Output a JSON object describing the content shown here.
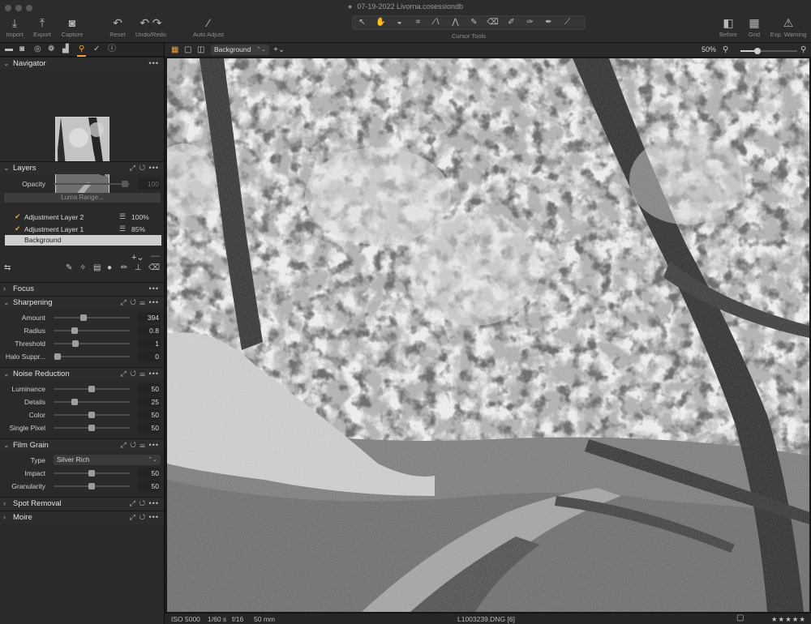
{
  "window": {
    "title": "07-19-2022 Livorna.cosessiondb"
  },
  "toolbar": {
    "import": "Import",
    "export": "Export",
    "capture": "Capture",
    "reset": "Reset",
    "undo_redo": "Undo/Redo",
    "auto_adjust": "Auto Adjust",
    "cursor_tools": "Cursor Tools",
    "before": "Before",
    "grid": "Grid",
    "exp_warning": "Exp. Warning"
  },
  "navigator": {
    "title": "Navigator"
  },
  "layers": {
    "title": "Layers",
    "opacity_label": "Opacity",
    "opacity_value": "100",
    "luma_range": "Luma Range...",
    "items": [
      {
        "name": "Adjustment Layer 2",
        "opacity": "100%"
      },
      {
        "name": "Adjustment Layer 1",
        "opacity": "85%"
      }
    ],
    "background": "Background"
  },
  "focus": {
    "title": "Focus"
  },
  "sharpening": {
    "title": "Sharpening",
    "rows": [
      {
        "label": "Amount",
        "value": "394",
        "level": 0.39
      },
      {
        "label": "Radius",
        "value": "0.8",
        "level": 0.28
      },
      {
        "label": "Threshold",
        "value": "1",
        "level": 0.29
      },
      {
        "label": "Halo Suppr...",
        "value": "0",
        "level": 0.05
      }
    ]
  },
  "noise_reduction": {
    "title": "Noise Reduction",
    "rows": [
      {
        "label": "Luminance",
        "value": "50",
        "level": 0.5
      },
      {
        "label": "Details",
        "value": "25",
        "level": 0.28
      },
      {
        "label": "Color",
        "value": "50",
        "level": 0.5
      },
      {
        "label": "Single Pixel",
        "value": "50",
        "level": 0.5
      }
    ]
  },
  "film_grain": {
    "title": "Film Grain",
    "type_label": "Type",
    "type_value": "Silver Rich",
    "rows": [
      {
        "label": "Impact",
        "value": "50",
        "level": 0.5
      },
      {
        "label": "Granularity",
        "value": "50",
        "level": 0.5
      }
    ]
  },
  "spot_removal": {
    "title": "Spot Removal"
  },
  "moire": {
    "title": "Moire"
  },
  "viewer": {
    "layer_select": "Background",
    "zoom": "50%",
    "zoom_level": 0.3
  },
  "status": {
    "iso": "ISO 5000",
    "shutter": "1/60 s",
    "aperture": "f/16",
    "focal": "50 mm",
    "filename": "L1003239.DNG [6]",
    "rating": "★★★★★"
  },
  "colors": {
    "accent": "#f0a13c",
    "panel": "#2a2a2a"
  }
}
